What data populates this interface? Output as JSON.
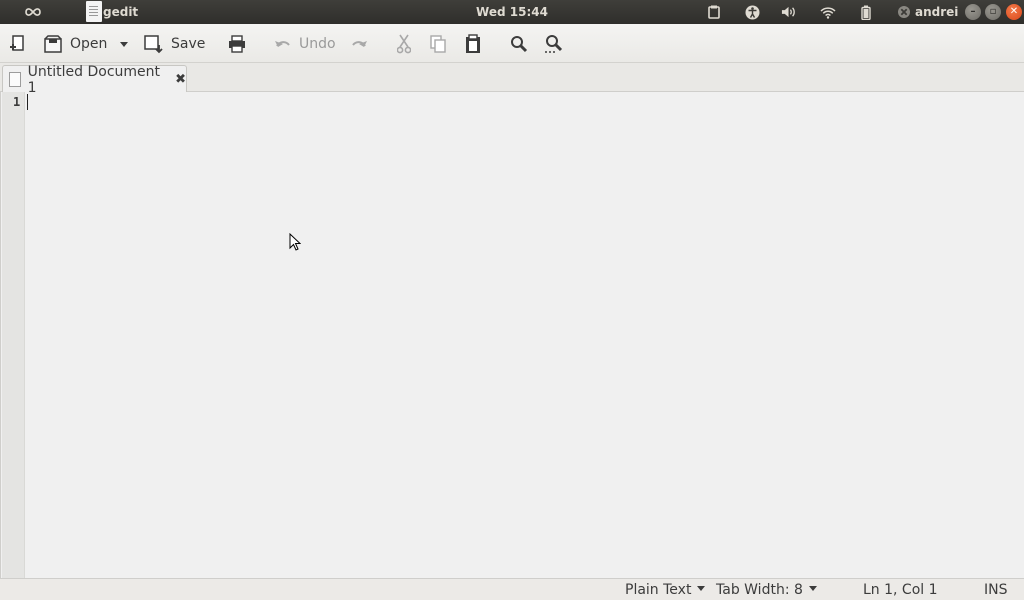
{
  "top_panel": {
    "app_name": "gedit",
    "clock": "Wed 15:44",
    "user": "andrei",
    "tray_icons": [
      "clipboard-icon",
      "accessibility-icon",
      "volume-icon",
      "wifi-icon",
      "battery-icon",
      "user-status-icon"
    ],
    "window_buttons": [
      "minimize-icon",
      "maximize-icon",
      "close-icon"
    ]
  },
  "toolbar": {
    "new_icon": "new-document-icon",
    "open_label": "Open",
    "save_label": "Save",
    "print_icon": "print-icon",
    "undo_label": "Undo",
    "redo_icon": "redo-icon",
    "cut_icon": "cut-icon",
    "copy_icon": "copy-icon",
    "paste_icon": "paste-icon",
    "find_icon": "find-icon",
    "replace_icon": "find-replace-icon"
  },
  "tabs": [
    {
      "title": "Untitled Document 1",
      "close_glyph": "✖"
    }
  ],
  "editor": {
    "line_numbers": [
      "1"
    ],
    "content": ""
  },
  "statusbar": {
    "language": "Plain Text",
    "tab_width_label": "Tab Width:",
    "tab_width_value": "8",
    "position": "Ln 1, Col 1",
    "mode": "INS"
  },
  "colors": {
    "panel_bg": "#3c3b37",
    "close_button": "#e9541d",
    "editor_bg": "#f0f0f0"
  }
}
